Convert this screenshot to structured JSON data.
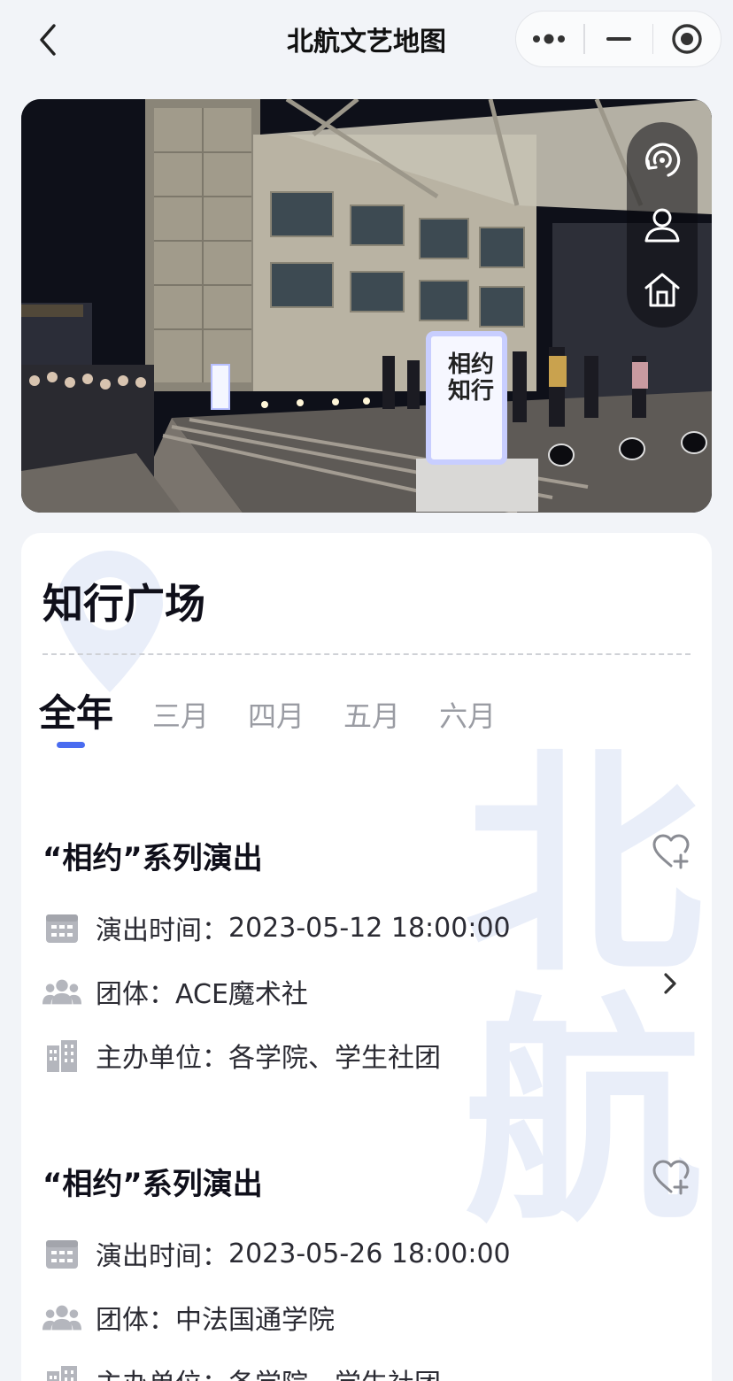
{
  "nav": {
    "title": "北航文艺地图",
    "back_icon": "chevron-left-icon",
    "more_icon": "more-dots-icon",
    "minimize_icon": "minimize-icon",
    "close_icon": "record-target-icon"
  },
  "hero": {
    "sign_text": "相约知行",
    "float_buttons": [
      "panorama-rotate-icon",
      "user-icon",
      "home-icon"
    ]
  },
  "place": {
    "name": "知行广场"
  },
  "tabs": [
    "全年",
    "三月",
    "四月",
    "五月",
    "六月"
  ],
  "active_tab": "全年",
  "watermark_chars": [
    "北",
    "航"
  ],
  "events": [
    {
      "title": "“相约”系列演出",
      "time_label": "演出时间：",
      "time_value": "2023-05-12 18:00:00",
      "group_label": "团体：",
      "group_value": "ACE魔术社",
      "host_label": "主办单位：",
      "host_value": "各学院、学生社团"
    },
    {
      "title": "“相约”系列演出",
      "time_label": "演出时间：",
      "time_value": "2023-05-26 18:00:00",
      "group_label": "团体：",
      "group_value": "中法国通学院",
      "host_label": "主办单位：",
      "host_value": "各学院、学生社团"
    }
  ],
  "colors": {
    "accent": "#4a6cf0",
    "watermark": "#e9eef9",
    "icon_gray": "#b4b6bd"
  }
}
